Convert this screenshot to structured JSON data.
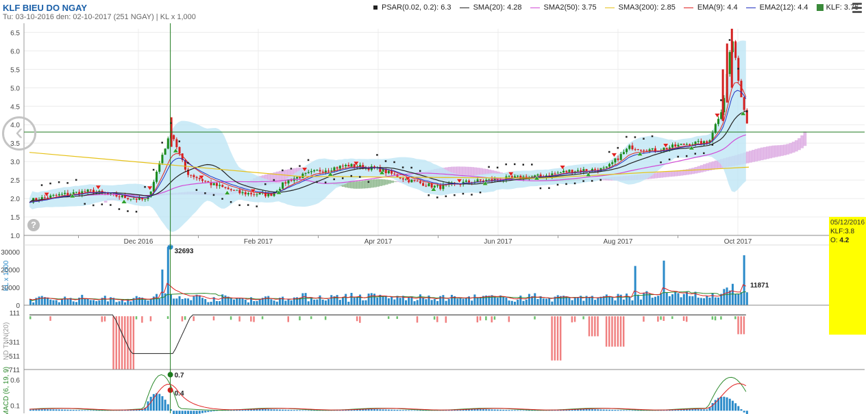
{
  "header": {
    "title": "KLF BIEU DO NGAY",
    "subtitle": "Tu: 03-10-2016 den: 02-10-2017 (251 NGAY) | KL x 1,000"
  },
  "legend": [
    {
      "label": "PSAR(0.02, 0.2): 6.3",
      "kind": "square",
      "color": "#222222"
    },
    {
      "label": "SMA(20): 4.28",
      "kind": "line",
      "color": "#222222"
    },
    {
      "label": "SMA2(50): 3.75",
      "kind": "line",
      "color": "#d14bd6"
    },
    {
      "label": "SMA3(200): 2.85",
      "kind": "line",
      "color": "#e6c21a"
    },
    {
      "label": "EMA(9): 4.4",
      "kind": "line",
      "color": "#e02020"
    },
    {
      "label": "EMA2(12): 4.4",
      "kind": "line",
      "color": "#2030c0"
    },
    {
      "label": "KLF: 3.76",
      "kind": "box",
      "color": "#3a8a3a"
    }
  ],
  "tooltip": {
    "date": "05/12/2016",
    "klf": "KLF:3.8",
    "o_label": "O:",
    "o_value": "4.2"
  },
  "help_label": "?",
  "chart_data": [
    {
      "type": "candlestick",
      "panel": "price",
      "ylim": [
        1.0,
        6.6
      ],
      "y_ticks": [
        "1.0",
        "1.5",
        "2.0",
        "2.5",
        "3.0",
        "3.5",
        "4.0",
        "4.5",
        "5.0",
        "5.5",
        "6.0",
        "6.5"
      ],
      "x_labels": [
        "Dec 2016",
        "Feb 2017",
        "Apr 2017",
        "Jun 2017",
        "Aug 2017",
        "Oct 2017"
      ],
      "price_keypoints": [
        {
          "month": 0.0,
          "close": 1.95
        },
        {
          "month": 0.5,
          "close": 2.1
        },
        {
          "month": 1.0,
          "close": 2.2
        },
        {
          "month": 1.5,
          "close": 2.05
        },
        {
          "month": 1.95,
          "close": 1.95
        },
        {
          "month": 2.2,
          "close": 3.2
        },
        {
          "month": 2.35,
          "close": 3.8
        },
        {
          "month": 2.6,
          "close": 2.7
        },
        {
          "month": 3.0,
          "close": 2.4
        },
        {
          "month": 3.5,
          "close": 2.15
        },
        {
          "month": 4.0,
          "close": 2.1
        },
        {
          "month": 4.3,
          "close": 2.5
        },
        {
          "month": 4.8,
          "close": 2.75
        },
        {
          "month": 5.3,
          "close": 2.9
        },
        {
          "month": 5.8,
          "close": 2.8
        },
        {
          "month": 6.3,
          "close": 2.5
        },
        {
          "month": 6.8,
          "close": 2.3
        },
        {
          "month": 7.3,
          "close": 2.45
        },
        {
          "month": 8.0,
          "close": 2.55
        },
        {
          "month": 8.5,
          "close": 2.6
        },
        {
          "month": 9.0,
          "close": 2.75
        },
        {
          "month": 9.6,
          "close": 2.8
        },
        {
          "month": 10.0,
          "close": 3.4
        },
        {
          "month": 10.4,
          "close": 3.3
        },
        {
          "month": 11.0,
          "close": 3.5
        },
        {
          "month": 11.3,
          "close": 3.5
        },
        {
          "month": 11.55,
          "close": 4.5
        },
        {
          "month": 11.7,
          "close": 6.4
        },
        {
          "month": 11.85,
          "close": 4.8
        },
        {
          "month": 12.0,
          "close": 3.76
        }
      ],
      "sma3_200": [
        {
          "month": 0.0,
          "value": 3.25
        },
        {
          "month": 4.5,
          "value": 2.6
        },
        {
          "month": 8.5,
          "value": 2.55
        },
        {
          "month": 12.0,
          "value": 2.85
        }
      ],
      "highlighted_date": "Dec 2016",
      "crosshair_value": 3.8
    },
    {
      "type": "bar",
      "panel": "volume",
      "ylabel": "KL x 1000",
      "y_ticks": [
        "0",
        "10000",
        "20000",
        "30000"
      ],
      "ylim": [
        0,
        33000
      ],
      "peak_label": "32693",
      "last_label": "11871",
      "notable_bars": [
        {
          "month": 2.3,
          "value": 32693
        },
        {
          "month": 2.2,
          "value": 20000
        },
        {
          "month": 10.1,
          "value": 22000
        },
        {
          "month": 10.55,
          "value": 25000
        },
        {
          "month": 11.9,
          "value": 28000
        },
        {
          "month": 12.0,
          "value": 11871
        }
      ]
    },
    {
      "type": "bar",
      "panel": "indicator",
      "ylabel": "ND TNN(20)",
      "y_ticks": [
        "111",
        "-311",
        "-511",
        "-711"
      ],
      "ylim": [
        -711,
        111
      ]
    },
    {
      "type": "bar",
      "panel": "macd",
      "ylabel": "MACD (6, 19, 9)",
      "y_ticks": [
        "0.6",
        "0.1"
      ],
      "ylim": [
        -0.05,
        0.8
      ],
      "labels": [
        "0.7",
        "0.4"
      ]
    }
  ]
}
